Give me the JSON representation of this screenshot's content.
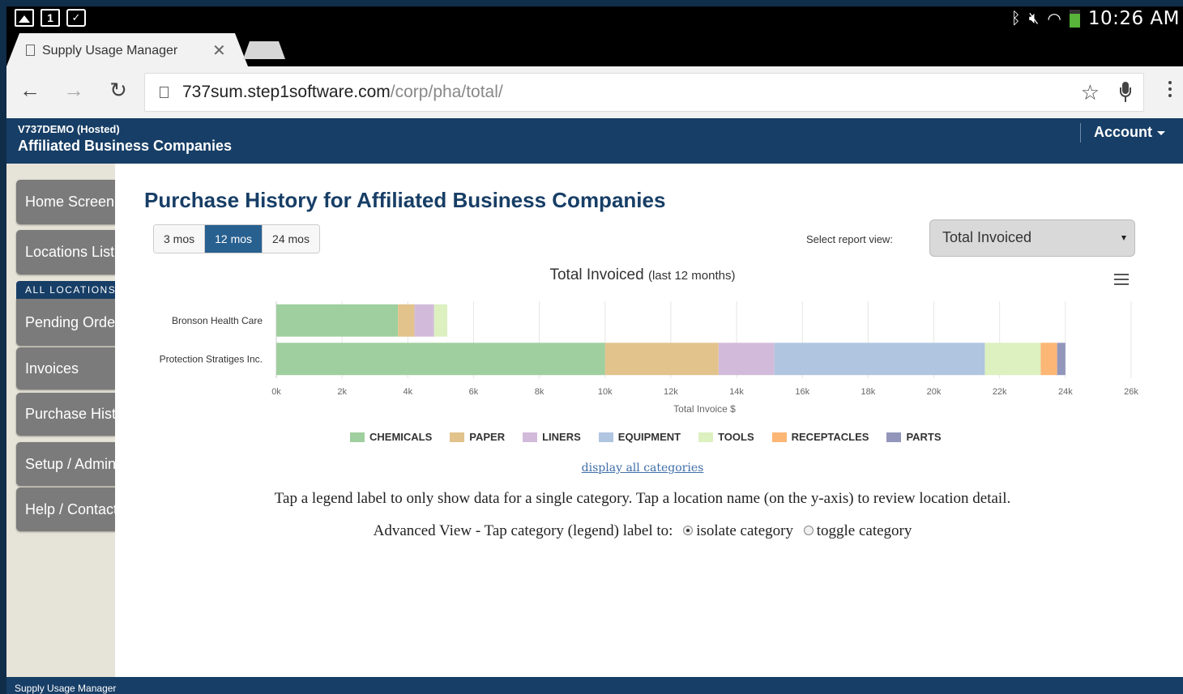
{
  "status_bar": {
    "time": "10:26 AM",
    "icons": [
      "picture-icon",
      "calendar-icon",
      "clipboard-check-icon",
      "bluetooth-icon",
      "silent-icon",
      "wifi-icon",
      "battery-icon"
    ]
  },
  "browser": {
    "tab_title": "Supply Usage Manager",
    "url_host": "737sum.step1software.com",
    "url_path": "/corp/pha/total/"
  },
  "app_header": {
    "tenant": "V737DEMO (Hosted)",
    "company": "Affiliated Business Companies",
    "account_label": "Account"
  },
  "sidebar": {
    "items": [
      {
        "label": "Home Screen"
      },
      {
        "label": "Locations List"
      },
      {
        "label": "Pending Orders"
      },
      {
        "label": "Invoices"
      },
      {
        "label": "Purchase History"
      },
      {
        "label": "Setup / Admin"
      },
      {
        "label": "Help / Contact"
      }
    ],
    "section_label": "ALL LOCATIONS"
  },
  "main": {
    "title": "Purchase History for Affiliated Business Companies",
    "ranges": [
      "3 mos",
      "12 mos",
      "24 mos"
    ],
    "active_range": "12 mos",
    "report_label": "Select report view:",
    "report_value": "Total Invoiced",
    "show_all_link": "display all categories",
    "help_text": "Tap a legend label to only show data for a single category. Tap a location name (on the y-axis) to review location detail.",
    "advanced_label": "Advanced View - Tap category (legend) label to:",
    "option_isolate": "isolate category",
    "option_toggle": "toggle category",
    "selected_option": "isolate category"
  },
  "chart_data": {
    "type": "bar",
    "orientation": "horizontal",
    "stacked": true,
    "title": "Total Invoiced",
    "subtitle": "(last 12 months)",
    "xlabel": "Total Invoice $",
    "ylabel": "",
    "xlim": [
      0,
      26000
    ],
    "x_ticks": [
      "0k",
      "2k",
      "4k",
      "6k",
      "8k",
      "10k",
      "12k",
      "14k",
      "16k",
      "18k",
      "20k",
      "22k",
      "24k",
      "26k"
    ],
    "grid": true,
    "legend": "bottom",
    "categories": [
      "Bronson Health Care",
      "Protection Stratiges Inc."
    ],
    "series": [
      {
        "name": "CHEMICALS",
        "color": "#9fcf9f",
        "values": [
          3700,
          10000
        ]
      },
      {
        "name": "PAPER",
        "color": "#e1c38b",
        "values": [
          500,
          3450
        ]
      },
      {
        "name": "LINERS",
        "color": "#d2bbda",
        "values": [
          600,
          1700
        ]
      },
      {
        "name": "EQUIPMENT",
        "color": "#b0c5e0",
        "values": [
          0,
          6400
        ]
      },
      {
        "name": "TOOLS",
        "color": "#dcf0c0",
        "values": [
          400,
          1700
        ]
      },
      {
        "name": "RECEPTACLES",
        "color": "#fcb675",
        "values": [
          0,
          500
        ]
      },
      {
        "name": "PARTS",
        "color": "#9396bb",
        "values": [
          0,
          250
        ]
      }
    ]
  },
  "footer": {
    "text": "Supply Usage Manager"
  }
}
